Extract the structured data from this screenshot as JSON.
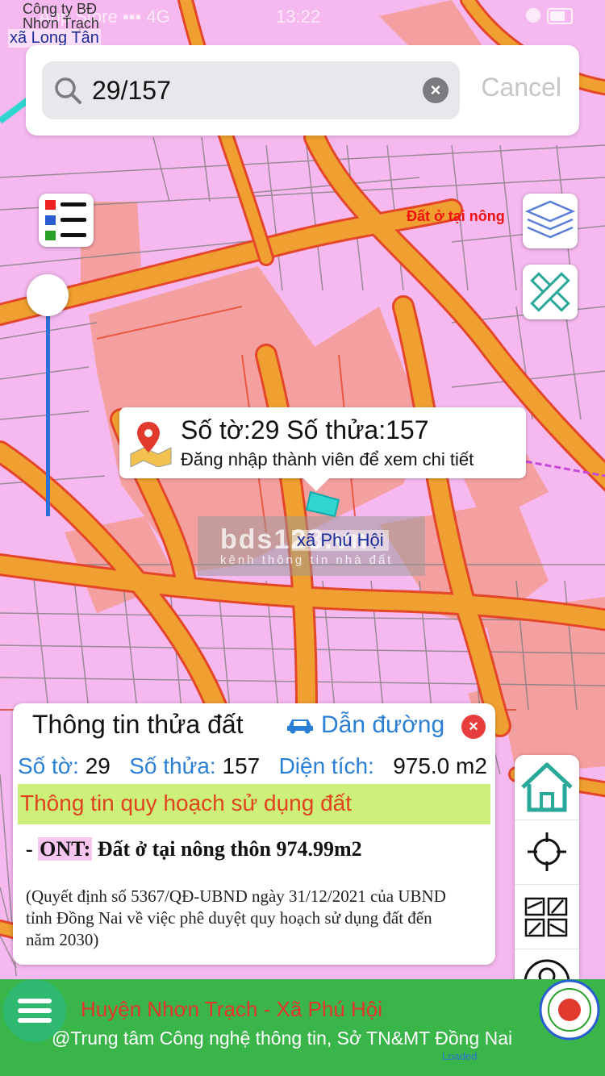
{
  "status_bar": {
    "carrier": "App Store",
    "network": "4G",
    "time": "13:22"
  },
  "map": {
    "company_line1": "Công ty BĐ",
    "company_line2": "Nhơn Trạch",
    "commune_top": "xã Long Tân",
    "land_label": "Đất ở tại nông",
    "commune_center": "xã Phú Hội",
    "watermark_big": "bds123.vn",
    "watermark_small": "kênh thông tin nhà đất"
  },
  "search": {
    "value": "29/157",
    "cancel_label": "Cancel",
    "icon": "search-icon"
  },
  "popup": {
    "title": "Số tờ:29 Số thửa:157",
    "subtitle": "Đăng nhập thành viên để xem chi tiết",
    "icon": "map-pin-icon"
  },
  "parcel_panel": {
    "title": "Thông tin thửa đất",
    "directions_label": "Dẫn đường",
    "sheet_label": "Số tờ:",
    "sheet_value": "29",
    "parcel_label": "Số thửa:",
    "parcel_value": "157",
    "area_label": "Diện tích:",
    "area_value": "975.0 m2",
    "plan_title": "Thông tin quy hoạch sử dụng đất",
    "landuse_prefix": "- ",
    "landuse_code": "ONT:",
    "landuse_desc": "Đất ở tại nông thôn 974.99m2",
    "decision": "(Quyết định số 5367/QĐ-UBND ngày 31/12/2021 của UBND tỉnh Đồng Nai về việc phê duyệt quy hoạch sử dụng đất đến năm 2030)"
  },
  "footer": {
    "line1": "Huyện Nhơn Trạch - Xã Phú Hội",
    "line2": "@Trung tâm Công nghệ thông tin, Sở TN&MT Đồng Nai",
    "status": "Loaded"
  },
  "colors": {
    "map_pink": "#f6b9ef",
    "map_salmon": "#f5a0a0",
    "road_orange": "#f0a030",
    "road_edge": "#e4462a",
    "accent_blue": "#2a7fd6",
    "plan_green": "#ccf07a",
    "footer_green": "#3ab54a",
    "footer_red": "#e4362a"
  }
}
